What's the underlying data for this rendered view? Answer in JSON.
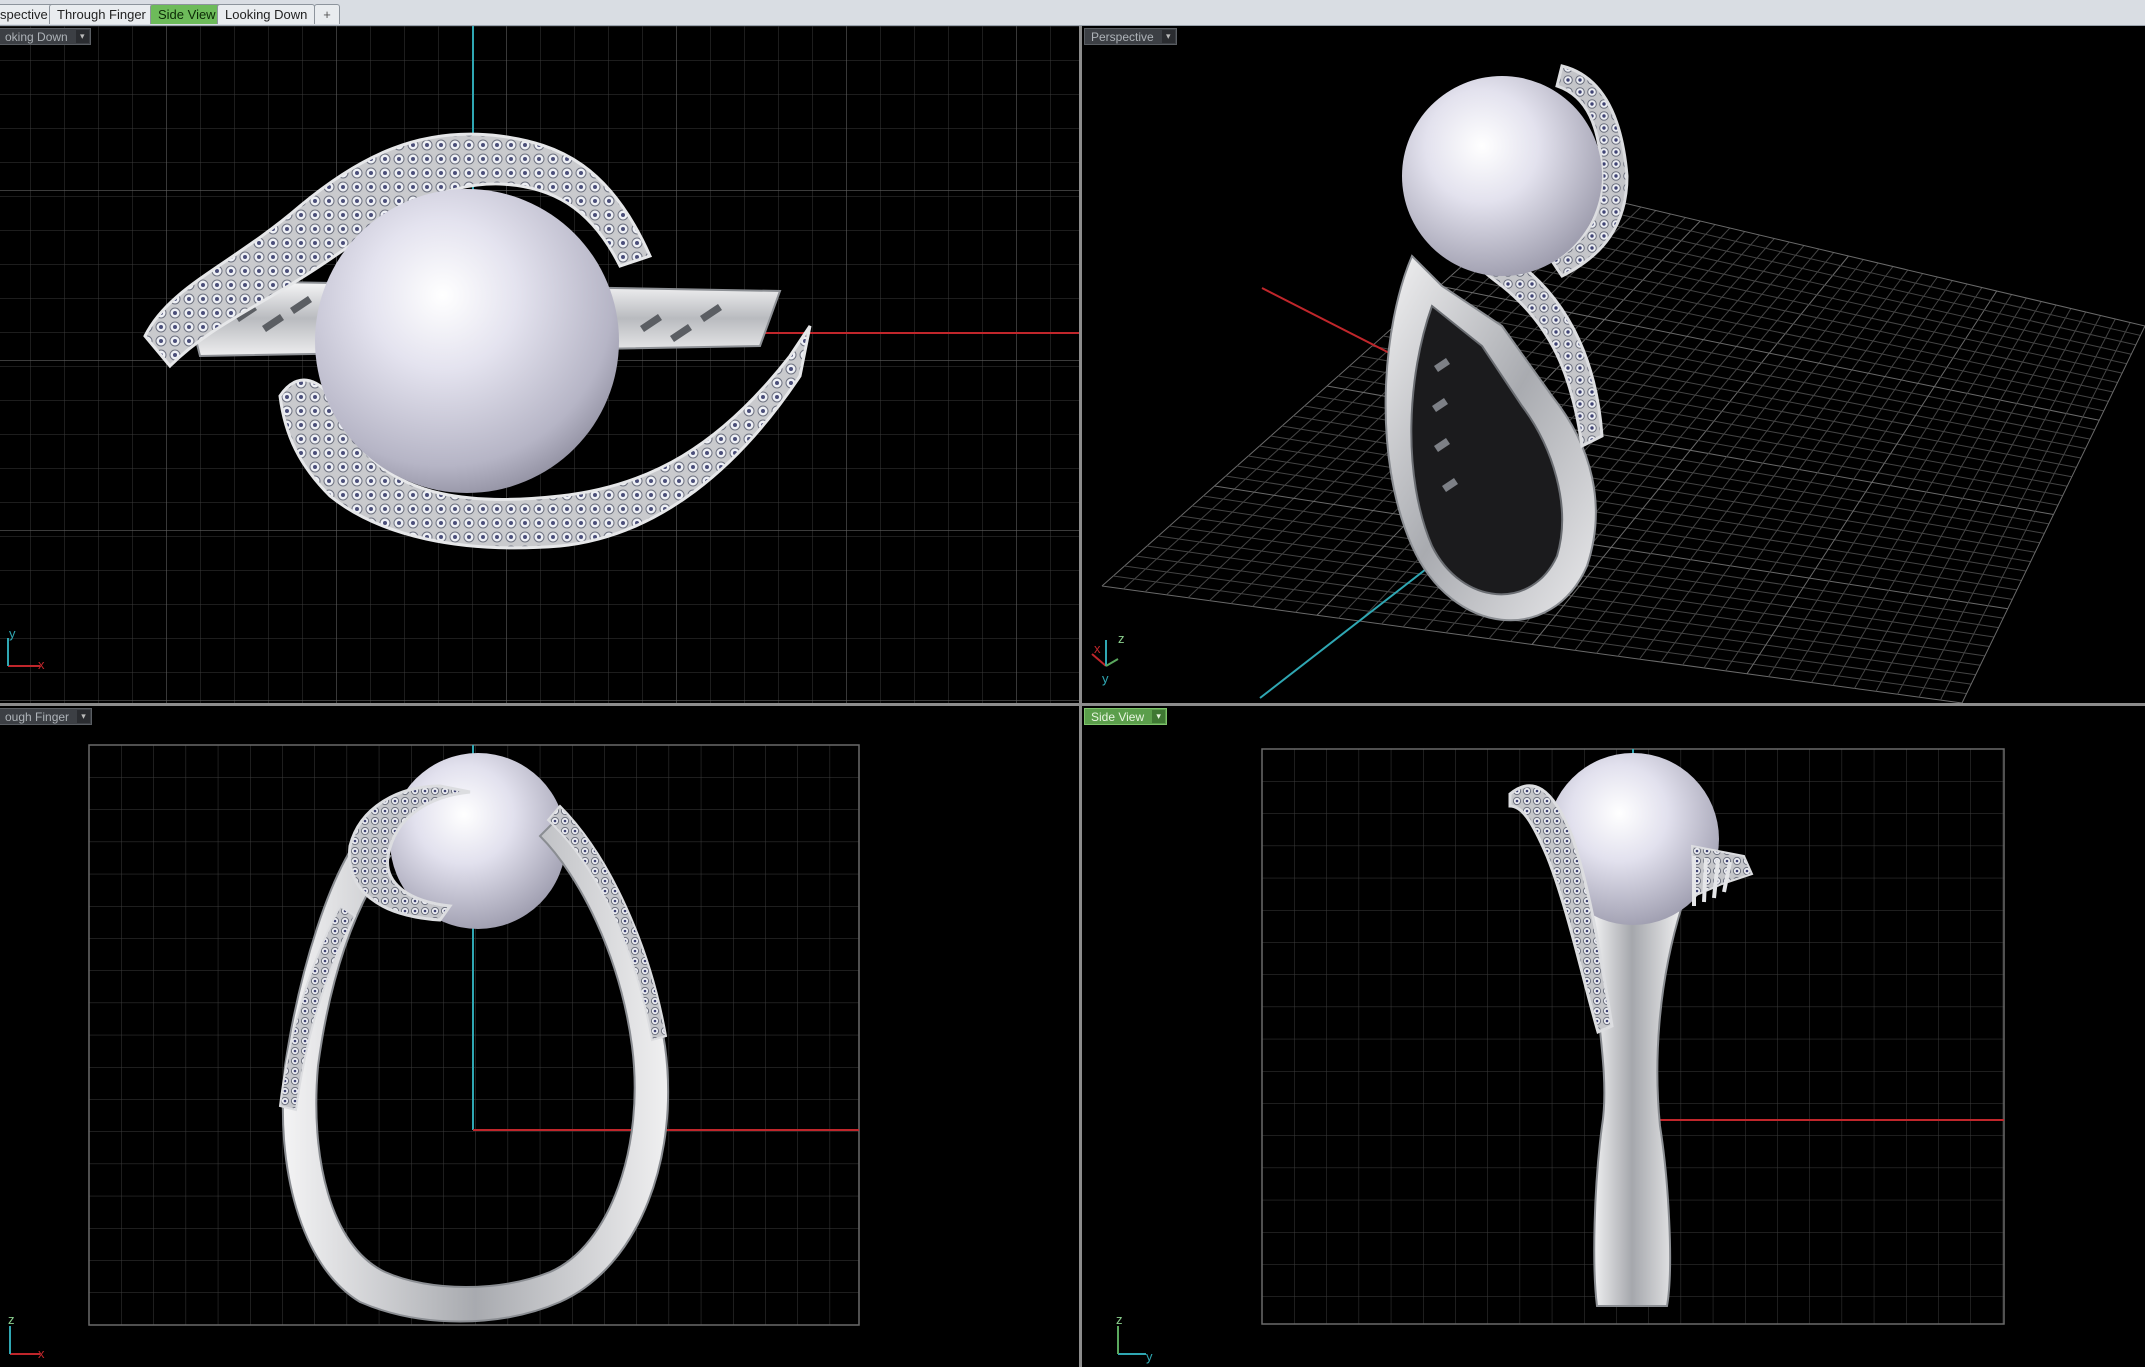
{
  "tabs": [
    {
      "label": "spective",
      "active": false
    },
    {
      "label": "Through Finger",
      "active": false
    },
    {
      "label": "Side View",
      "active": true
    },
    {
      "label": "Looking Down",
      "active": false
    },
    {
      "label": "+",
      "active": false
    }
  ],
  "viewports": {
    "top_left": {
      "label": "oking Down",
      "axes": [
        "y",
        "x"
      ]
    },
    "top_right": {
      "label": "Perspective",
      "axes": [
        "z",
        "x",
        "y"
      ]
    },
    "bottom_left": {
      "label": "ough Finger",
      "axes": [
        "z",
        "x"
      ]
    },
    "bottom_right": {
      "label": "Side View",
      "active": true,
      "axes": [
        "z",
        "y"
      ]
    }
  },
  "colors": {
    "background": "#000000",
    "grid": "#3a3a3a",
    "grid_major": "#6a6a6a",
    "axis_red": "#c0262b",
    "axis_cyan": "#2fa7b3",
    "metal": "#d8dadd",
    "pearl": "#dcdbe8",
    "active_tab": "#6dbb5a"
  }
}
